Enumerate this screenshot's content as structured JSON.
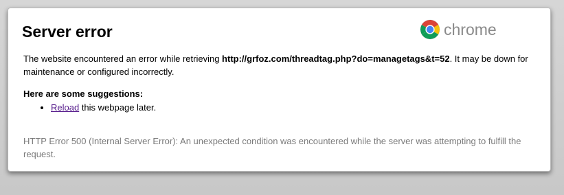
{
  "error": {
    "title": "Server error",
    "message_before": "The website encountered an error while retrieving ",
    "url": "http://grfoz.com/threadtag.php?do=managetags&t=52",
    "message_after": ". It may be down for maintenance or configured incorrectly.",
    "suggestions_title": "Here are some suggestions:",
    "suggestion_link": "Reload",
    "suggestion_rest": " this webpage later.",
    "details": "HTTP Error 500 (Internal Server Error): An unexpected condition was encountered while the server was attempting to fulfill the request."
  },
  "branding": {
    "label": "chrome",
    "logo_icon": "chrome-logo-icon"
  },
  "colors": {
    "background": "#cfcfcf",
    "card": "#ffffff",
    "link_visited": "#551a8b",
    "details_text": "#7a7a7a",
    "brand_text": "#8a8a8a"
  }
}
